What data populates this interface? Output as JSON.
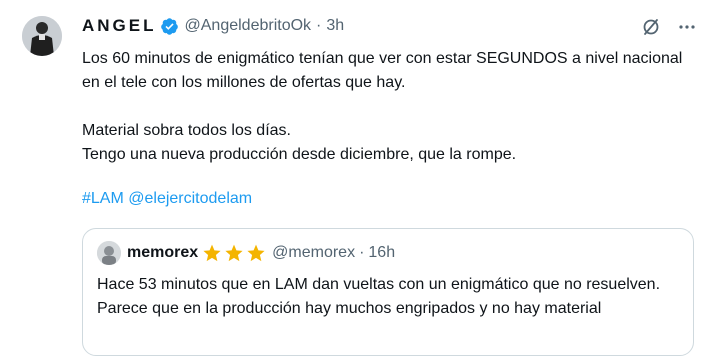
{
  "tweet": {
    "author": {
      "display_name": "ANGEL",
      "handle": "@AngeldebritoOk",
      "time": "3h",
      "avatar_icon": "person-avatar-icon"
    },
    "separator": "·",
    "body": [
      "Los 60 minutos de enigmático tenían que ver con estar SEGUNDOS a nivel nacional en el tele con los millones de ofertas que hay.",
      "",
      "Material sobra todos los días.",
      "Tengo una nueva producción desde diciembre, que la rompe."
    ],
    "hashtag": "#LAM",
    "mention": "@elejercitodelam",
    "colors": {
      "link": "#1d9bf0",
      "verified": "#1d9bf0",
      "star": "#f4b400",
      "muted": "#536471"
    },
    "quoted": {
      "display_name": "memorex",
      "stars": 3,
      "handle": "@memorex",
      "time": "16h",
      "body": [
        "Hace 53 minutos que en LAM dan vueltas con un enigmático que no resuelven.",
        "Parece que en la producción hay muchos engripados y no hay material"
      ]
    }
  }
}
